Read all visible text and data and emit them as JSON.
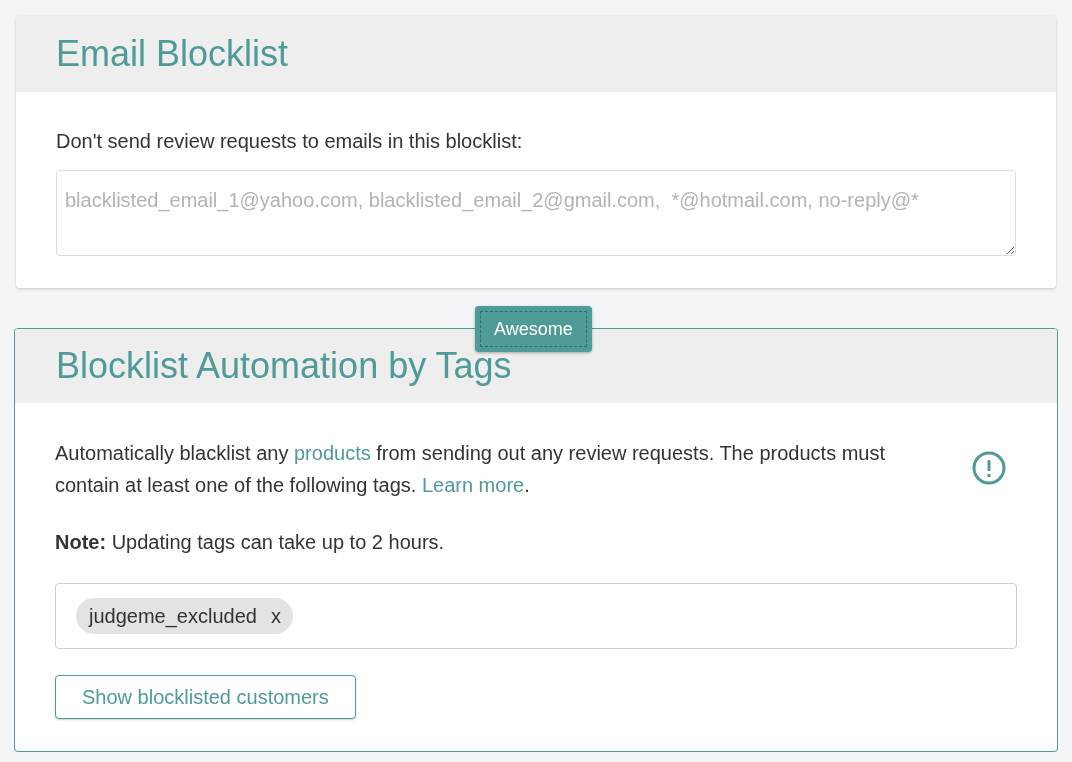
{
  "email_blocklist": {
    "title": "Email Blocklist",
    "label": "Don't send review requests to emails in this blocklist:",
    "field": {
      "placeholder": "blacklisted_email_1@yahoo.com, blacklisted_email_2@gmail.com,  *@hotmail.com, no-reply@*"
    }
  },
  "tooltip": "Awesome",
  "tag_automation": {
    "title": "Blocklist Automation by Tags",
    "description": [
      {
        "kind": "text",
        "text": "Automatically blacklist any "
      },
      {
        "kind": "link",
        "text": "products"
      },
      {
        "kind": "text",
        "text": " from sending out any review requests. The products must contain at least one of the following tags. "
      },
      {
        "kind": "link",
        "text": "Learn more"
      },
      {
        "kind": "text",
        "text": "."
      }
    ],
    "note": "**Note:** Updating tags can take up to 2 hours.",
    "tags": [
      {
        "label": "judgeme_excluded",
        "remove": "x"
      }
    ],
    "button": "Show blocklisted customers"
  }
}
